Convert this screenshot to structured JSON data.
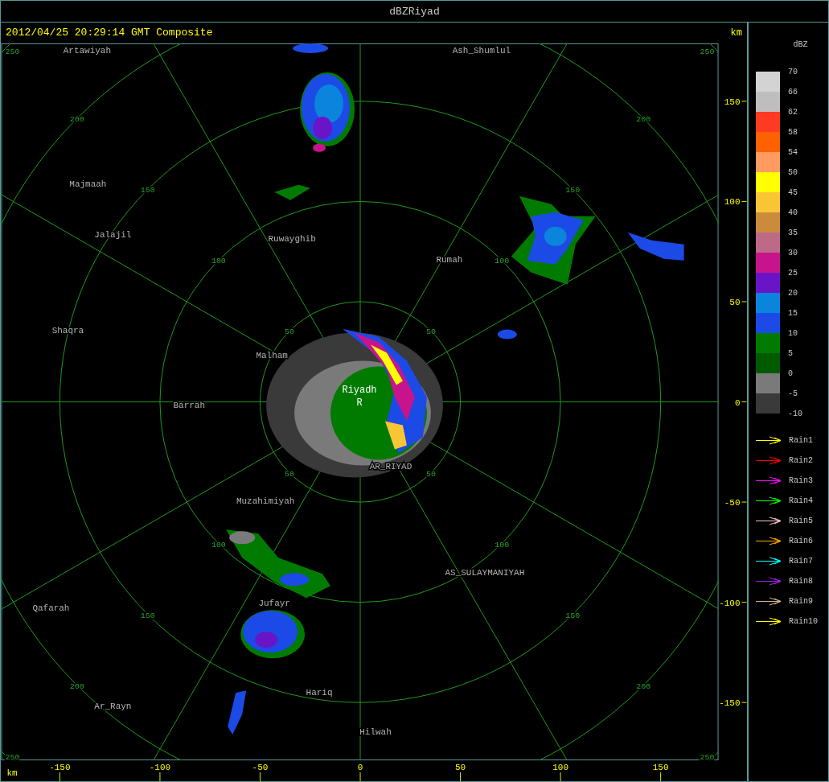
{
  "window": {
    "title": "dBZRiyad"
  },
  "header": {
    "timestamp": "2012/04/25 20:29:14 GMT Composite",
    "unit": "km"
  },
  "map": {
    "ring_labels": [
      [
        "50",
        "50",
        "50",
        "50"
      ],
      [
        "100",
        "100",
        "100",
        "100"
      ],
      [
        "150",
        "150",
        "150",
        "150"
      ],
      [
        "200",
        "200",
        "200",
        "200"
      ],
      [
        "250",
        "250",
        "250",
        "250"
      ]
    ],
    "places": [
      {
        "name": "Artawiyah",
        "kind": "city"
      },
      {
        "name": "Ash_Shumlul",
        "kind": "city"
      },
      {
        "name": "Majmaah",
        "kind": "city"
      },
      {
        "name": "Jalajil",
        "kind": "city"
      },
      {
        "name": "Ruwayghib",
        "kind": "city"
      },
      {
        "name": "Rumah",
        "kind": "city"
      },
      {
        "name": "Shaqra",
        "kind": "city"
      },
      {
        "name": "Malham",
        "kind": "city"
      },
      {
        "name": "Riyadh",
        "kind": "site"
      },
      {
        "name": "R",
        "kind": "site"
      },
      {
        "name": "Barrah",
        "kind": "city"
      },
      {
        "name": "AR_RIYAD",
        "kind": "city"
      },
      {
        "name": "Muzahimiyah",
        "kind": "city"
      },
      {
        "name": "AS_SULAYMANIYAH",
        "kind": "city"
      },
      {
        "name": "Qafarah",
        "kind": "city"
      },
      {
        "name": "Jufayr",
        "kind": "city"
      },
      {
        "name": "Hariq",
        "kind": "city"
      },
      {
        "name": "Ar_Rayn",
        "kind": "city"
      },
      {
        "name": "Hilwah",
        "kind": "city"
      }
    ]
  },
  "x_axis": {
    "unit": "km",
    "ticks": [
      "-150",
      "-100",
      "-50",
      "0",
      "50",
      "100",
      "150"
    ]
  },
  "y_axis": {
    "ticks": [
      "150",
      "100",
      "50",
      "0",
      "-50",
      "-100",
      "-150"
    ]
  },
  "legend": {
    "title": "dBZ",
    "bins": [
      {
        "color": "#d3d3d3"
      },
      {
        "color": "#bebebe"
      },
      {
        "color": "#ff3a22"
      },
      {
        "color": "#ff6000"
      },
      {
        "color": "#ff9b5f"
      },
      {
        "color": "#ffff00"
      },
      {
        "color": "#f9c535"
      },
      {
        "color": "#cc8a3d"
      },
      {
        "color": "#bd6a88"
      },
      {
        "color": "#c8148c"
      },
      {
        "color": "#6a14c8"
      },
      {
        "color": "#0a84dc"
      },
      {
        "color": "#1c4ae6"
      },
      {
        "color": "#007b00"
      },
      {
        "color": "#005a00"
      },
      {
        "color": "#7a7a7a"
      },
      {
        "color": "#3a3a3a"
      }
    ],
    "labels": [
      "70",
      "66",
      "62",
      "58",
      "54",
      "50",
      "45",
      "40",
      "35",
      "30",
      "25",
      "20",
      "15",
      "10",
      "5",
      "0",
      "-5",
      "-10"
    ]
  },
  "rain_tracks": [
    {
      "label": "Rain1",
      "color": "#ffff00"
    },
    {
      "label": "Rain2",
      "color": "#ff0000"
    },
    {
      "label": "Rain3",
      "color": "#ff00ff"
    },
    {
      "label": "Rain4",
      "color": "#00ff00"
    },
    {
      "label": "Rain5",
      "color": "#ffc0cb"
    },
    {
      "label": "Rain6",
      "color": "#ffa500"
    },
    {
      "label": "Rain7",
      "color": "#00ffff"
    },
    {
      "label": "Rain8",
      "color": "#a020f0"
    },
    {
      "label": "Rain9",
      "color": "#d2b48c"
    },
    {
      "label": "Rain10",
      "color": "#ffff00"
    }
  ]
}
